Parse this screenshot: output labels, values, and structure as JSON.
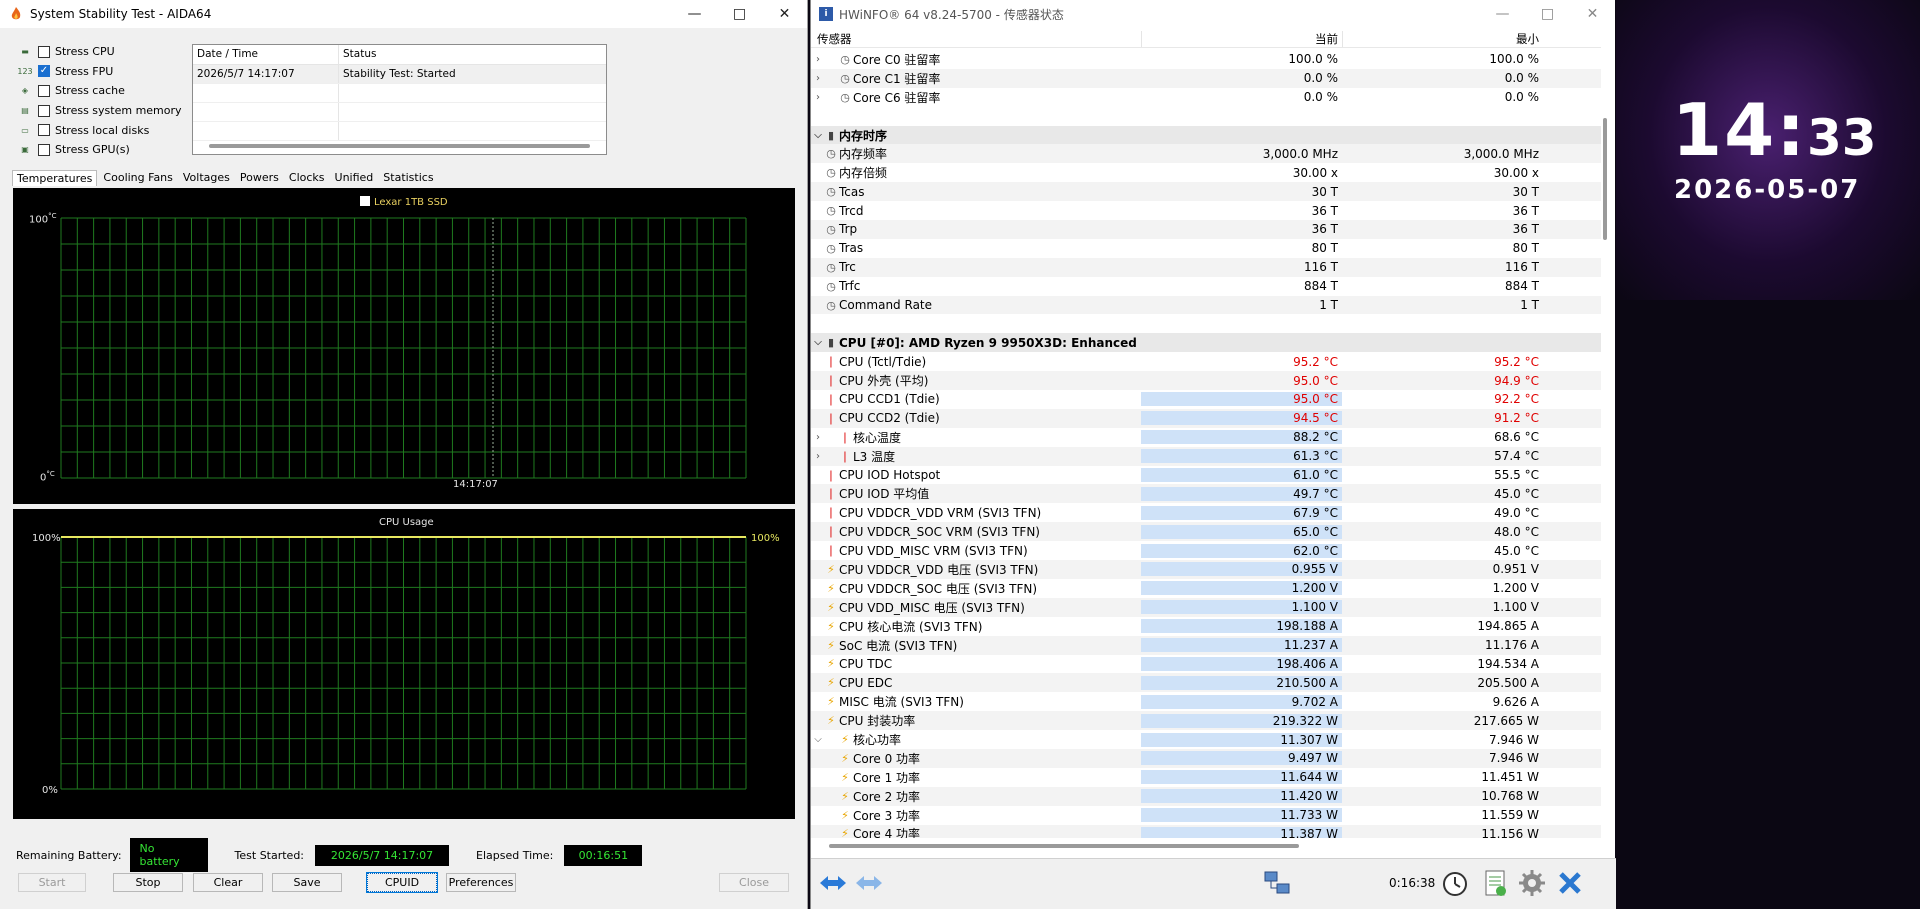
{
  "aida": {
    "title": "System Stability Test - AIDA64",
    "stress_items": [
      {
        "label": "Stress CPU",
        "checked": false,
        "icon": "cpu-chip-icon"
      },
      {
        "label": "Stress FPU",
        "checked": true,
        "icon": "fpu-icon"
      },
      {
        "label": "Stress cache",
        "checked": false,
        "icon": "cache-icon"
      },
      {
        "label": "Stress system memory",
        "checked": false,
        "icon": "memory-icon"
      },
      {
        "label": "Stress local disks",
        "checked": false,
        "icon": "disk-icon"
      },
      {
        "label": "Stress GPU(s)",
        "checked": false,
        "icon": "gpu-icon"
      }
    ],
    "log": {
      "col_datetime": "Date / Time",
      "col_status": "Status",
      "rows": [
        {
          "datetime": "2026/5/7 14:17:07",
          "status": "Stability Test: Started"
        }
      ]
    },
    "tabs": [
      "Temperatures",
      "Cooling Fans",
      "Voltages",
      "Powers",
      "Clocks",
      "Unified",
      "Statistics"
    ],
    "temp_graph": {
      "legend": "Lexar 1TB SSD",
      "ymax": "100",
      "ymin": "0",
      "unit": "°C",
      "time_label": "14:17:07"
    },
    "cpu_graph": {
      "title": "CPU Usage",
      "ymax": "100%",
      "ymin": "0%",
      "current": "100%"
    },
    "info": {
      "battery_label": "Remaining Battery:",
      "battery_value": "No battery",
      "started_label": "Test Started:",
      "started_value": "2026/5/7 14:17:07",
      "elapsed_label": "Elapsed Time:",
      "elapsed_value": "00:16:51"
    },
    "buttons": {
      "start": "Start",
      "stop": "Stop",
      "clear": "Clear",
      "save": "Save",
      "cpuid": "CPUID",
      "preferences": "Preferences",
      "close": "Close"
    }
  },
  "hwinfo": {
    "title": "HWiNFO® 64 v8.24-5700 - 传感器状态",
    "col_sensor": "传感器",
    "col_current": "当前",
    "col_min": "最小",
    "rows": [
      {
        "type": "item",
        "name": "Core C0 驻留率",
        "v1": "100.0 %",
        "v2": "100.0 %",
        "icon": "clock",
        "indent": 1,
        "expand": ">"
      },
      {
        "type": "item",
        "name": "Core C1 驻留率",
        "v1": "0.0 %",
        "v2": "0.0 %",
        "icon": "clock",
        "indent": 1,
        "expand": ">"
      },
      {
        "type": "item",
        "name": "Core C6 驻留率",
        "v1": "0.0 %",
        "v2": "0.0 %",
        "icon": "clock",
        "indent": 1,
        "expand": ">"
      },
      {
        "type": "blank"
      },
      {
        "type": "group",
        "name": "内存时序",
        "expand": "v"
      },
      {
        "type": "item",
        "name": "内存频率",
        "v1": "3,000.0 MHz",
        "v2": "3,000.0 MHz",
        "icon": "clock"
      },
      {
        "type": "item",
        "name": "内存倍频",
        "v1": "30.00 x",
        "v2": "30.00 x",
        "icon": "clock"
      },
      {
        "type": "item",
        "name": "Tcas",
        "v1": "30 T",
        "v2": "30 T",
        "icon": "clock"
      },
      {
        "type": "item",
        "name": "Trcd",
        "v1": "36 T",
        "v2": "36 T",
        "icon": "clock"
      },
      {
        "type": "item",
        "name": "Trp",
        "v1": "36 T",
        "v2": "36 T",
        "icon": "clock"
      },
      {
        "type": "item",
        "name": "Tras",
        "v1": "80 T",
        "v2": "80 T",
        "icon": "clock"
      },
      {
        "type": "item",
        "name": "Trc",
        "v1": "116 T",
        "v2": "116 T",
        "icon": "clock"
      },
      {
        "type": "item",
        "name": "Trfc",
        "v1": "884 T",
        "v2": "884 T",
        "icon": "clock"
      },
      {
        "type": "item",
        "name": "Command Rate",
        "v1": "1 T",
        "v2": "1 T",
        "icon": "clock"
      },
      {
        "type": "blank"
      },
      {
        "type": "group",
        "name": "CPU [#0]: AMD Ryzen 9 9950X3D: Enhanced",
        "expand": "v"
      },
      {
        "type": "item",
        "name": "CPU (Tctl/Tdie)",
        "v1": "95.2 °C",
        "v2": "95.2 °C",
        "icon": "temp",
        "hot": true
      },
      {
        "type": "item",
        "name": "CPU 外壳 (平均)",
        "v1": "95.0 °C",
        "v2": "94.9 °C",
        "icon": "temp",
        "hot": true
      },
      {
        "type": "item",
        "name": "CPU CCD1 (Tdie)",
        "v1": "95.0 °C",
        "v2": "92.2 °C",
        "icon": "temp",
        "hot": true,
        "hl": true
      },
      {
        "type": "item",
        "name": "CPU CCD2 (Tdie)",
        "v1": "94.5 °C",
        "v2": "91.2 °C",
        "icon": "temp",
        "hot": true,
        "hl": true
      },
      {
        "type": "item",
        "name": "核心温度",
        "v1": "88.2 °C",
        "v2": "68.6 °C",
        "icon": "temp",
        "indent": 1,
        "expand": ">",
        "hl": true
      },
      {
        "type": "item",
        "name": "L3 温度",
        "v1": "61.3 °C",
        "v2": "57.4 °C",
        "icon": "temp",
        "indent": 1,
        "expand": ">",
        "hl": true
      },
      {
        "type": "item",
        "name": "CPU IOD Hotspot",
        "v1": "61.0 °C",
        "v2": "55.5 °C",
        "icon": "temp",
        "hl": true
      },
      {
        "type": "item",
        "name": "CPU IOD 平均值",
        "v1": "49.7 °C",
        "v2": "45.0 °C",
        "icon": "temp",
        "hl": true
      },
      {
        "type": "item",
        "name": "CPU VDDCR_VDD VRM (SVI3 TFN)",
        "v1": "67.9 °C",
        "v2": "49.0 °C",
        "icon": "temp",
        "hl": true
      },
      {
        "type": "item",
        "name": "CPU VDDCR_SOC VRM (SVI3 TFN)",
        "v1": "65.0 °C",
        "v2": "48.0 °C",
        "icon": "temp",
        "hl": true
      },
      {
        "type": "item",
        "name": "CPU VDD_MISC VRM (SVI3 TFN)",
        "v1": "62.0 °C",
        "v2": "45.0 °C",
        "icon": "temp",
        "hl": true
      },
      {
        "type": "item",
        "name": "CPU VDDCR_VDD 电压 (SVI3 TFN)",
        "v1": "0.955 V",
        "v2": "0.951 V",
        "icon": "volt",
        "hl": true
      },
      {
        "type": "item",
        "name": "CPU VDDCR_SOC 电压 (SVI3 TFN)",
        "v1": "1.200 V",
        "v2": "1.200 V",
        "icon": "volt",
        "hl": true
      },
      {
        "type": "item",
        "name": "CPU VDD_MISC 电压 (SVI3 TFN)",
        "v1": "1.100 V",
        "v2": "1.100 V",
        "icon": "volt",
        "hl": true
      },
      {
        "type": "item",
        "name": "CPU 核心电流 (SVI3 TFN)",
        "v1": "198.188 A",
        "v2": "194.865 A",
        "icon": "volt",
        "hl": true
      },
      {
        "type": "item",
        "name": "SoC 电流 (SVI3 TFN)",
        "v1": "11.237 A",
        "v2": "11.176 A",
        "icon": "volt",
        "hl": true
      },
      {
        "type": "item",
        "name": "CPU TDC",
        "v1": "198.406 A",
        "v2": "194.534 A",
        "icon": "volt",
        "hl": true
      },
      {
        "type": "item",
        "name": "CPU EDC",
        "v1": "210.500 A",
        "v2": "205.500 A",
        "icon": "volt",
        "hl": true
      },
      {
        "type": "item",
        "name": "MISC 电流 (SVI3 TFN)",
        "v1": "9.702 A",
        "v2": "9.626 A",
        "icon": "volt",
        "hl": true
      },
      {
        "type": "item",
        "name": "CPU 封装功率",
        "v1": "219.322 W",
        "v2": "217.665 W",
        "icon": "volt",
        "hl": true
      },
      {
        "type": "item",
        "name": "核心功率",
        "v1": "11.307 W",
        "v2": "7.946 W",
        "icon": "volt",
        "indent": 1,
        "expand": "v",
        "hl": true
      },
      {
        "type": "item",
        "name": "Core 0 功率",
        "v1": "9.497 W",
        "v2": "7.946 W",
        "icon": "volt",
        "indent": 1,
        "hl": true
      },
      {
        "type": "item",
        "name": "Core 1 功率",
        "v1": "11.644 W",
        "v2": "11.451 W",
        "icon": "volt",
        "indent": 1,
        "hl": true
      },
      {
        "type": "item",
        "name": "Core 2 功率",
        "v1": "11.420 W",
        "v2": "10.768 W",
        "icon": "volt",
        "indent": 1,
        "hl": true
      },
      {
        "type": "item",
        "name": "Core 3 功率",
        "v1": "11.733 W",
        "v2": "11.559 W",
        "icon": "volt",
        "indent": 1,
        "hl": true
      },
      {
        "type": "item",
        "name": "Core 4 功率",
        "v1": "11.387 W",
        "v2": "11.156 W",
        "icon": "volt",
        "indent": 1,
        "hl": true
      }
    ],
    "timer": "0:16:38"
  },
  "clock": {
    "hour": "14",
    "sep": ":",
    "minute": "33",
    "date": "2026-05-07"
  }
}
